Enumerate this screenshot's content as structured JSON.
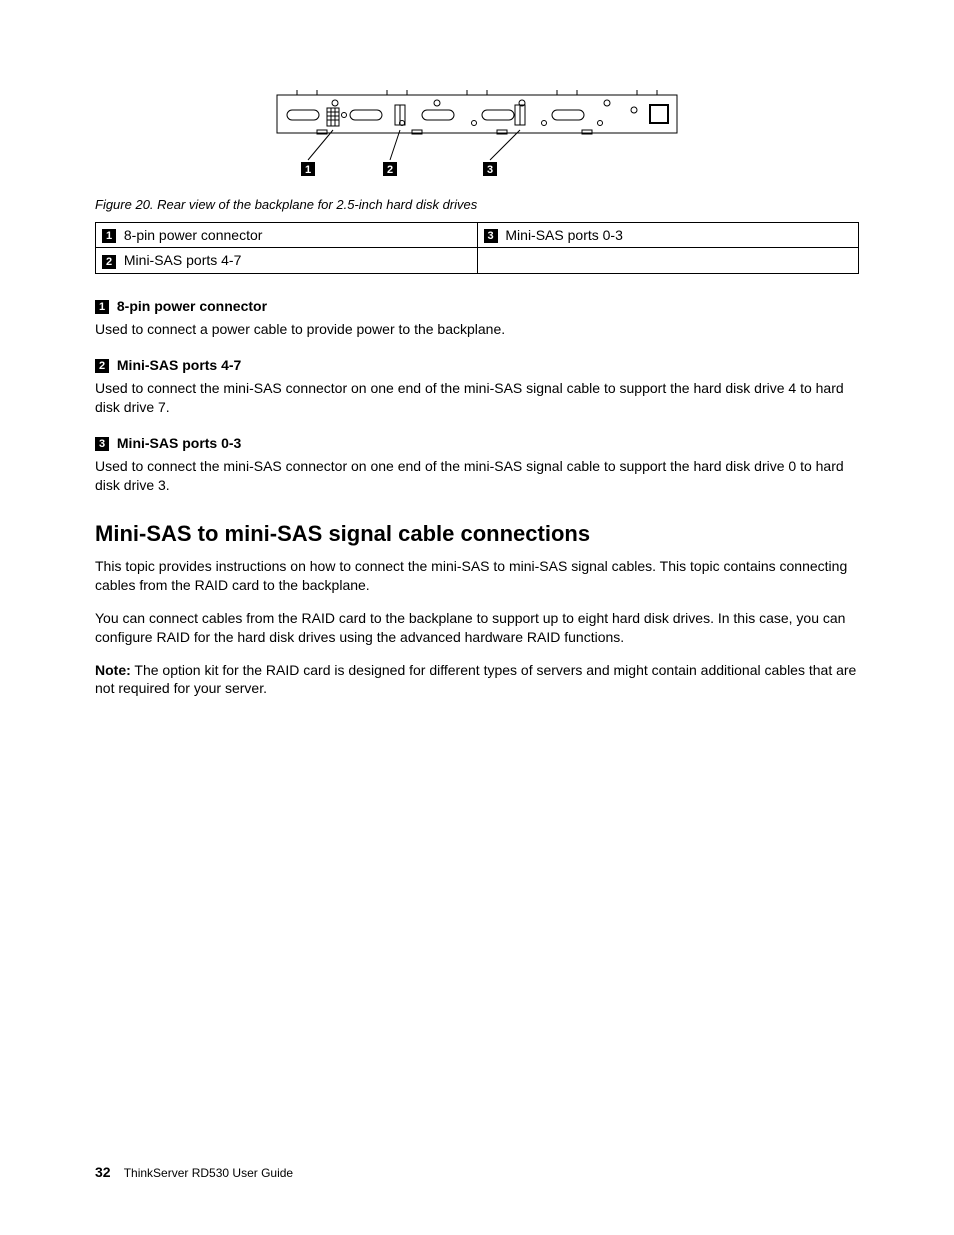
{
  "figure": {
    "caption": "Figure 20.  Rear view of the backplane for 2.5-inch hard disk drives",
    "callouts": [
      "1",
      "2",
      "3"
    ]
  },
  "legend": {
    "cells": [
      {
        "num": "1",
        "text": "8-pin power connector"
      },
      {
        "num": "3",
        "text": "Mini-SAS ports 0-3"
      },
      {
        "num": "2",
        "text": "Mini-SAS ports 4-7"
      },
      {
        "num": "",
        "text": ""
      }
    ]
  },
  "descs": [
    {
      "num": "1",
      "title": "8-pin power connector",
      "body": "Used to connect a power cable to provide power to the backplane."
    },
    {
      "num": "2",
      "title": "Mini-SAS ports 4-7",
      "body": "Used to connect the mini-SAS connector on one end of the mini-SAS signal cable to support the hard disk drive 4 to hard disk drive 7."
    },
    {
      "num": "3",
      "title": "Mini-SAS ports 0-3",
      "body": "Used to connect the mini-SAS connector on one end of the mini-SAS signal cable to support the hard disk drive 0 to hard disk drive 3."
    }
  ],
  "section": {
    "title": "Mini-SAS to mini-SAS signal cable connections",
    "p1": "This topic provides instructions on how to connect the mini-SAS to mini-SAS signal cables. This topic contains connecting cables from the RAID card to the backplane.",
    "p2": "You can connect cables from the RAID card to the backplane to support up to eight hard disk drives. In this case, you can configure RAID for the hard disk drives using the advanced hardware RAID functions.",
    "noteLabel": "Note:",
    "noteBody": " The option kit for the RAID card is designed for different types of servers and might contain additional cables that are not required for your server."
  },
  "footer": {
    "page": "32",
    "doc": "ThinkServer RD530 User Guide"
  }
}
